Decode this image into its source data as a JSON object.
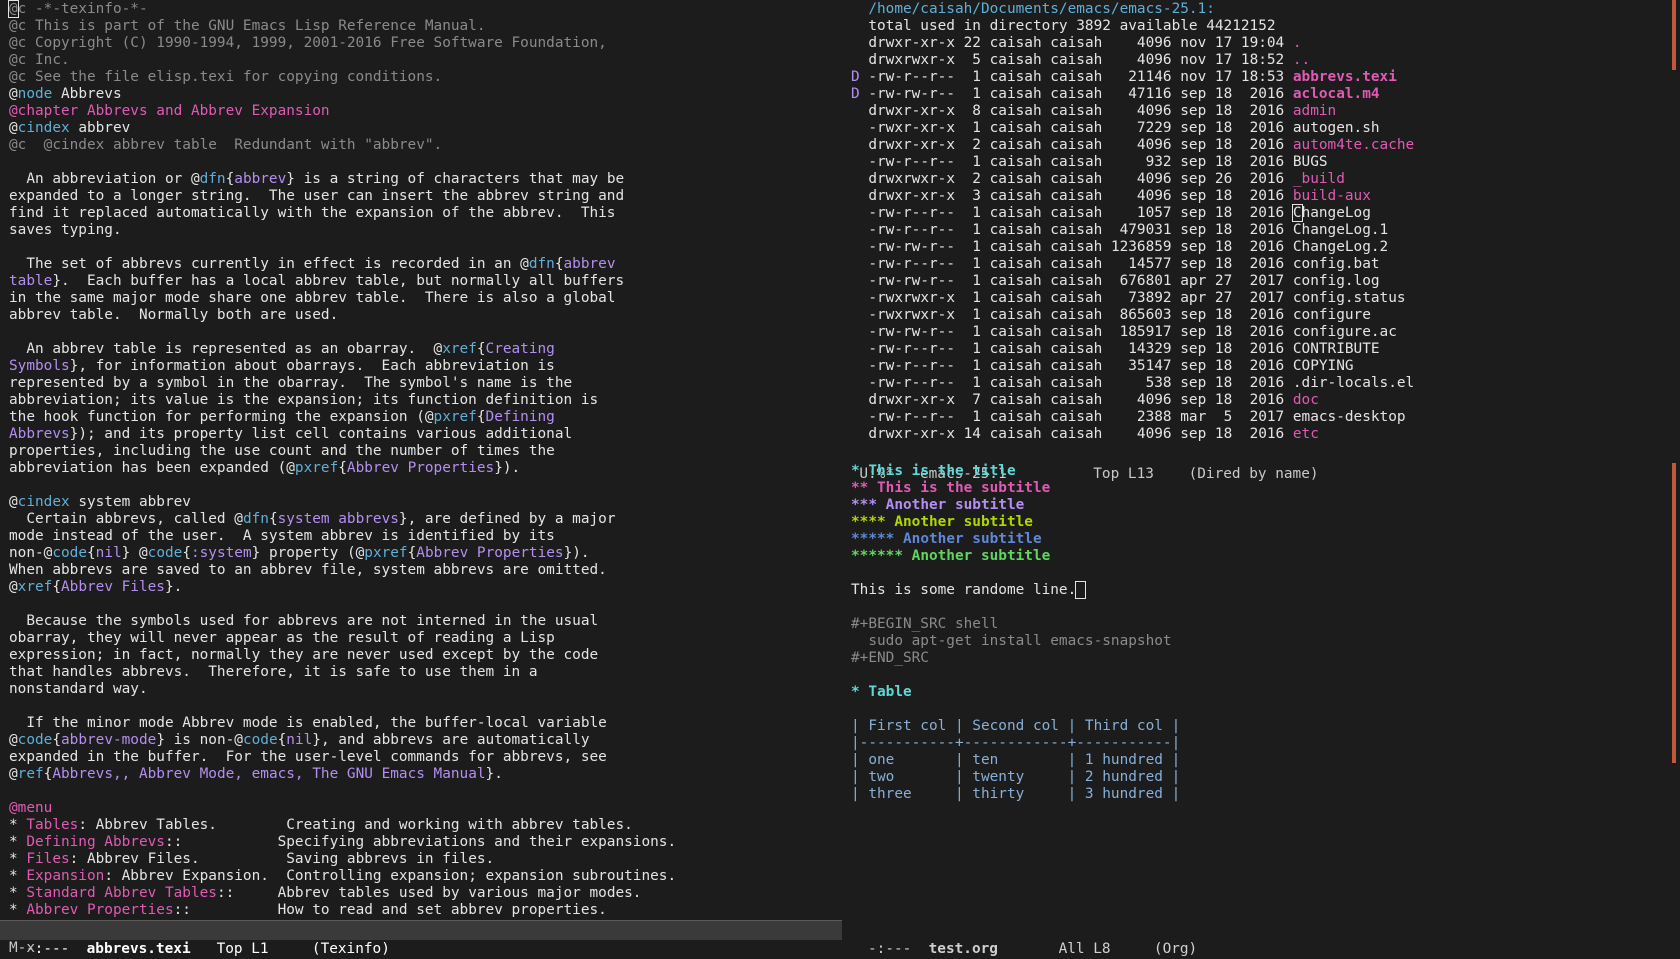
{
  "left": {
    "lines": [
      [
        [
          "c-com",
          "@c -*-texinfo-*-"
        ]
      ],
      [
        [
          "c-com",
          "@c This is part of the GNU Emacs Lisp Reference Manual."
        ]
      ],
      [
        [
          "c-com",
          "@c Copyright (C) 1990-1994, 1999, 2001-2016 Free Software Foundation,"
        ]
      ],
      [
        [
          "c-com",
          "@c Inc."
        ]
      ],
      [
        [
          "c-com",
          "@c See the file elisp.texi for copying conditions."
        ]
      ],
      [
        [
          "c-white",
          "@"
        ],
        [
          "c-kw",
          "node"
        ],
        [
          "c-white",
          " Abbrevs"
        ]
      ],
      [
        [
          "c-chap",
          "@chapter Abbrevs and Abbrev Expansion"
        ]
      ],
      [
        [
          "c-white",
          "@"
        ],
        [
          "c-kw",
          "cindex"
        ],
        [
          "c-white",
          " abbrev"
        ]
      ],
      [
        [
          "c-com",
          "@c  @cindex abbrev table  Redundant with \"abbrev\"."
        ]
      ],
      [
        [
          "c-white",
          ""
        ]
      ],
      [
        [
          "c-white",
          "  An abbreviation or @"
        ],
        [
          "c-kw",
          "dfn"
        ],
        [
          "c-white",
          "{"
        ],
        [
          "c-purple",
          "abbrev"
        ],
        [
          "c-white",
          "} is a string of characters that may be"
        ]
      ],
      [
        [
          "c-white",
          "expanded to a longer string.  The user can insert the abbrev string and"
        ]
      ],
      [
        [
          "c-white",
          "find it replaced automatically with the expansion of the abbrev.  This"
        ]
      ],
      [
        [
          "c-white",
          "saves typing."
        ]
      ],
      [
        [
          "c-white",
          ""
        ]
      ],
      [
        [
          "c-white",
          "  The set of abbrevs currently in effect is recorded in an @"
        ],
        [
          "c-kw",
          "dfn"
        ],
        [
          "c-white",
          "{"
        ],
        [
          "c-purple",
          "abbrev"
        ]
      ],
      [
        [
          "c-purple",
          "table"
        ],
        [
          "c-white",
          "}.  Each buffer has a local abbrev table, but normally all buffers"
        ]
      ],
      [
        [
          "c-white",
          "in the same major mode share one abbrev table.  There is also a global"
        ]
      ],
      [
        [
          "c-white",
          "abbrev table.  Normally both are used."
        ]
      ],
      [
        [
          "c-white",
          ""
        ]
      ],
      [
        [
          "c-white",
          "  An abbrev table is represented as an obarray.  @"
        ],
        [
          "c-kw",
          "xref"
        ],
        [
          "c-white",
          "{"
        ],
        [
          "c-purple",
          "Creating"
        ]
      ],
      [
        [
          "c-purple",
          "Symbols"
        ],
        [
          "c-white",
          "}, for information about obarrays.  Each abbreviation is"
        ]
      ],
      [
        [
          "c-white",
          "represented by a symbol in the obarray.  The symbol's name is the"
        ]
      ],
      [
        [
          "c-white",
          "abbreviation; its value is the expansion; its function definition is"
        ]
      ],
      [
        [
          "c-white",
          "the hook function for performing the expansion (@"
        ],
        [
          "c-kw",
          "pxref"
        ],
        [
          "c-white",
          "{"
        ],
        [
          "c-purple",
          "Defining"
        ]
      ],
      [
        [
          "c-purple",
          "Abbrevs"
        ],
        [
          "c-white",
          "}); and its property list cell contains various additional"
        ]
      ],
      [
        [
          "c-white",
          "properties, including the use count and the number of times the"
        ]
      ],
      [
        [
          "c-white",
          "abbreviation has been expanded (@"
        ],
        [
          "c-kw",
          "pxref"
        ],
        [
          "c-white",
          "{"
        ],
        [
          "c-purple",
          "Abbrev Properties"
        ],
        [
          "c-white",
          "})."
        ]
      ],
      [
        [
          "c-white",
          ""
        ]
      ],
      [
        [
          "c-white",
          "@"
        ],
        [
          "c-kw",
          "cindex"
        ],
        [
          "c-white",
          " system abbrev"
        ]
      ],
      [
        [
          "c-white",
          "  Certain abbrevs, called @"
        ],
        [
          "c-kw",
          "dfn"
        ],
        [
          "c-white",
          "{"
        ],
        [
          "c-purple",
          "system abbrevs"
        ],
        [
          "c-white",
          "}, are defined by a major"
        ]
      ],
      [
        [
          "c-white",
          "mode instead of the user.  A system abbrev is identified by its"
        ]
      ],
      [
        [
          "c-white",
          "non-@"
        ],
        [
          "c-kw",
          "code"
        ],
        [
          "c-white",
          "{"
        ],
        [
          "c-purple",
          "nil"
        ],
        [
          "c-white",
          "} @"
        ],
        [
          "c-kw",
          "code"
        ],
        [
          "c-white",
          "{"
        ],
        [
          "c-purple",
          ":system"
        ],
        [
          "c-white",
          "} property (@"
        ],
        [
          "c-kw",
          "pxref"
        ],
        [
          "c-white",
          "{"
        ],
        [
          "c-purple",
          "Abbrev Properties"
        ],
        [
          "c-white",
          "})."
        ]
      ],
      [
        [
          "c-white",
          "When abbrevs are saved to an abbrev file, system abbrevs are omitted."
        ]
      ],
      [
        [
          "c-white",
          "@"
        ],
        [
          "c-kw",
          "xref"
        ],
        [
          "c-white",
          "{"
        ],
        [
          "c-purple",
          "Abbrev Files"
        ],
        [
          "c-white",
          "}."
        ]
      ],
      [
        [
          "c-white",
          ""
        ]
      ],
      [
        [
          "c-white",
          "  Because the symbols used for abbrevs are not interned in the usual"
        ]
      ],
      [
        [
          "c-white",
          "obarray, they will never appear as the result of reading a Lisp"
        ]
      ],
      [
        [
          "c-white",
          "expression; in fact, normally they are never used except by the code"
        ]
      ],
      [
        [
          "c-white",
          "that handles abbrevs.  Therefore, it is safe to use them in a"
        ]
      ],
      [
        [
          "c-white",
          "nonstandard way."
        ]
      ],
      [
        [
          "c-white",
          ""
        ]
      ],
      [
        [
          "c-white",
          "  If the minor mode Abbrev mode is enabled, the buffer-local variable"
        ]
      ],
      [
        [
          "c-white",
          "@"
        ],
        [
          "c-kw",
          "code"
        ],
        [
          "c-white",
          "{"
        ],
        [
          "c-purple",
          "abbrev-mode"
        ],
        [
          "c-white",
          "} is non-@"
        ],
        [
          "c-kw",
          "code"
        ],
        [
          "c-white",
          "{"
        ],
        [
          "c-purple",
          "nil"
        ],
        [
          "c-white",
          "}, and abbrevs are automatically"
        ]
      ],
      [
        [
          "c-white",
          "expanded in the buffer.  For the user-level commands for abbrevs, see"
        ]
      ],
      [
        [
          "c-white",
          "@"
        ],
        [
          "c-kw",
          "ref"
        ],
        [
          "c-white",
          "{"
        ],
        [
          "c-purple",
          "Abbrevs,, Abbrev Mode, emacs, The GNU Emacs Manual"
        ],
        [
          "c-white",
          "}."
        ]
      ],
      [
        [
          "c-white",
          ""
        ]
      ],
      [
        [
          "c-mag",
          "@menu"
        ]
      ],
      [
        [
          "c-white",
          "* "
        ],
        [
          "c-mag",
          "Tables"
        ],
        [
          "c-white",
          ": Abbrev Tables.        Creating and working with abbrev tables."
        ]
      ],
      [
        [
          "c-white",
          "* "
        ],
        [
          "c-mag",
          "Defining Abbrevs"
        ],
        [
          "c-white",
          "::           Specifying abbreviations and their expansions."
        ]
      ],
      [
        [
          "c-white",
          "* "
        ],
        [
          "c-mag",
          "Files"
        ],
        [
          "c-white",
          ": Abbrev Files.          Saving abbrevs in files."
        ]
      ],
      [
        [
          "c-white",
          "* "
        ],
        [
          "c-mag",
          "Expansion"
        ],
        [
          "c-white",
          ": Abbrev Expansion.  Controlling expansion; expansion subroutines."
        ]
      ],
      [
        [
          "c-white",
          "* "
        ],
        [
          "c-mag",
          "Standard Abbrev Tables"
        ],
        [
          "c-white",
          "::     Abbrev tables used by various major modes."
        ]
      ],
      [
        [
          "c-white",
          "* "
        ],
        [
          "c-mag",
          "Abbrev Properties"
        ],
        [
          "c-white",
          "::          How to read and set abbrev properties."
        ]
      ]
    ],
    "modeline": {
      "state": " -:---  ",
      "buffer": "abbrevs.texi",
      "position": "   Top L1     ",
      "mode": "(Texinfo)"
    }
  },
  "dired": {
    "header": "  /home/caisah/Documents/emacs/emacs-25.1:",
    "total": "  total used in directory 3892 available 44212152",
    "entries": [
      {
        "mark": " ",
        "perm": "drwxr-xr-x",
        "links": "22",
        "size": "4096",
        "date": "nov 17 19:04",
        "name": ".",
        "kind": "dir"
      },
      {
        "mark": " ",
        "perm": "drwxrwxr-x",
        "links": " 5",
        "size": "4096",
        "date": "nov 17 18:52",
        "name": "..",
        "kind": "dir"
      },
      {
        "mark": "D",
        "perm": "-rw-r--r--",
        "links": " 1",
        "size": "21146",
        "date": "nov 17 18:53",
        "name": "abbrevs.texi",
        "kind": "marked"
      },
      {
        "mark": "D",
        "perm": "-rw-rw-r--",
        "links": " 1",
        "size": "47116",
        "date": "sep 18  2016",
        "name": "aclocal.m4",
        "kind": "marked"
      },
      {
        "mark": " ",
        "perm": "drwxr-xr-x",
        "links": " 8",
        "size": "4096",
        "date": "sep 18  2016",
        "name": "admin",
        "kind": "dir"
      },
      {
        "mark": " ",
        "perm": "-rwxr-xr-x",
        "links": " 1",
        "size": "7229",
        "date": "sep 18  2016",
        "name": "autogen.sh",
        "kind": "file"
      },
      {
        "mark": " ",
        "perm": "drwxr-xr-x",
        "links": " 2",
        "size": "4096",
        "date": "sep 18  2016",
        "name": "autom4te.cache",
        "kind": "dir"
      },
      {
        "mark": " ",
        "perm": "-rw-r--r--",
        "links": " 1",
        "size": "932",
        "date": "sep 18  2016",
        "name": "BUGS",
        "kind": "file"
      },
      {
        "mark": " ",
        "perm": "drwxrwxr-x",
        "links": " 2",
        "size": "4096",
        "date": "sep 26  2016",
        "name": "_build",
        "kind": "dir"
      },
      {
        "mark": " ",
        "perm": "drwxr-xr-x",
        "links": " 3",
        "size": "4096",
        "date": "sep 18  2016",
        "name": "build-aux",
        "kind": "dir"
      },
      {
        "mark": " ",
        "perm": "-rw-r--r--",
        "links": " 1",
        "size": "1057",
        "date": "sep 18  2016",
        "name": "ChangeLog",
        "kind": "cursor"
      },
      {
        "mark": " ",
        "perm": "-rw-r--r--",
        "links": " 1",
        "size": "479031",
        "date": "sep 18  2016",
        "name": "ChangeLog.1",
        "kind": "file"
      },
      {
        "mark": " ",
        "perm": "-rw-rw-r--",
        "links": " 1",
        "size": "1236859",
        "date": "sep 18  2016",
        "name": "ChangeLog.2",
        "kind": "file"
      },
      {
        "mark": " ",
        "perm": "-rw-r--r--",
        "links": " 1",
        "size": "14577",
        "date": "sep 18  2016",
        "name": "config.bat",
        "kind": "file"
      },
      {
        "mark": " ",
        "perm": "-rw-rw-r--",
        "links": " 1",
        "size": "676801",
        "date": "apr 27  2017",
        "name": "config.log",
        "kind": "file"
      },
      {
        "mark": " ",
        "perm": "-rwxrwxr-x",
        "links": " 1",
        "size": "73892",
        "date": "apr 27  2017",
        "name": "config.status",
        "kind": "file"
      },
      {
        "mark": " ",
        "perm": "-rwxrwxr-x",
        "links": " 1",
        "size": "865603",
        "date": "sep 18  2016",
        "name": "configure",
        "kind": "file"
      },
      {
        "mark": " ",
        "perm": "-rw-rw-r--",
        "links": " 1",
        "size": "185917",
        "date": "sep 18  2016",
        "name": "configure.ac",
        "kind": "file"
      },
      {
        "mark": " ",
        "perm": "-rw-r--r--",
        "links": " 1",
        "size": "14329",
        "date": "sep 18  2016",
        "name": "CONTRIBUTE",
        "kind": "file"
      },
      {
        "mark": " ",
        "perm": "-rw-r--r--",
        "links": " 1",
        "size": "35147",
        "date": "sep 18  2016",
        "name": "COPYING",
        "kind": "file"
      },
      {
        "mark": " ",
        "perm": "-rw-r--r--",
        "links": " 1",
        "size": "538",
        "date": "sep 18  2016",
        "name": ".dir-locals.el",
        "kind": "file"
      },
      {
        "mark": " ",
        "perm": "drwxr-xr-x",
        "links": " 7",
        "size": "4096",
        "date": "sep 18  2016",
        "name": "doc",
        "kind": "dir"
      },
      {
        "mark": " ",
        "perm": "-rw-r--r--",
        "links": " 1",
        "size": "2388",
        "date": "mar  5  2017",
        "name": "emacs-desktop",
        "kind": "file"
      },
      {
        "mark": " ",
        "perm": "drwxr-xr-x",
        "links": "14",
        "size": "4096",
        "date": "sep 18  2016",
        "name": "etc",
        "kind": "dir"
      }
    ],
    "owner": "caisah caisah",
    "modeline": {
      "state": "U:%*-  ",
      "buffer": "emacs-25.1",
      "position": "          Top L13    ",
      "mode": "(Dired by name)"
    }
  },
  "org": {
    "headings": [
      {
        "stars": "*",
        "text": "This is the title",
        "cls": "c-h1"
      },
      {
        "stars": "**",
        "text": "This is the subtitle",
        "cls": "c-h2"
      },
      {
        "stars": "***",
        "text": "Another subtitle",
        "cls": "c-h3"
      },
      {
        "stars": "****",
        "text": "Another subtitle",
        "cls": "c-h4"
      },
      {
        "stars": "*****",
        "text": "Another subtitle",
        "cls": "c-h5"
      },
      {
        "stars": "******",
        "text": "Another subtitle",
        "cls": "c-h6"
      }
    ],
    "random_line": "This is some randome line.",
    "src_begin": "#+BEGIN_SRC shell",
    "src_code": "  sudo apt-get install emacs-snapshot",
    "src_end": "#+END_SRC",
    "table_heading": "* Table",
    "table_header": "| First col | Second col | Third col |",
    "table_rule": "|-----------+------------+-----------|",
    "table_rows": [
      "| one       | ten        | 1 hundred |",
      "| two       | twenty     | 2 hundred |",
      "| three     | thirty     | 3 hundred |"
    ],
    "modeline": {
      "state": " -:---  ",
      "buffer": "test.org",
      "position": "       All L8     ",
      "mode": "(Org)"
    }
  },
  "minibuffer": "M-x"
}
